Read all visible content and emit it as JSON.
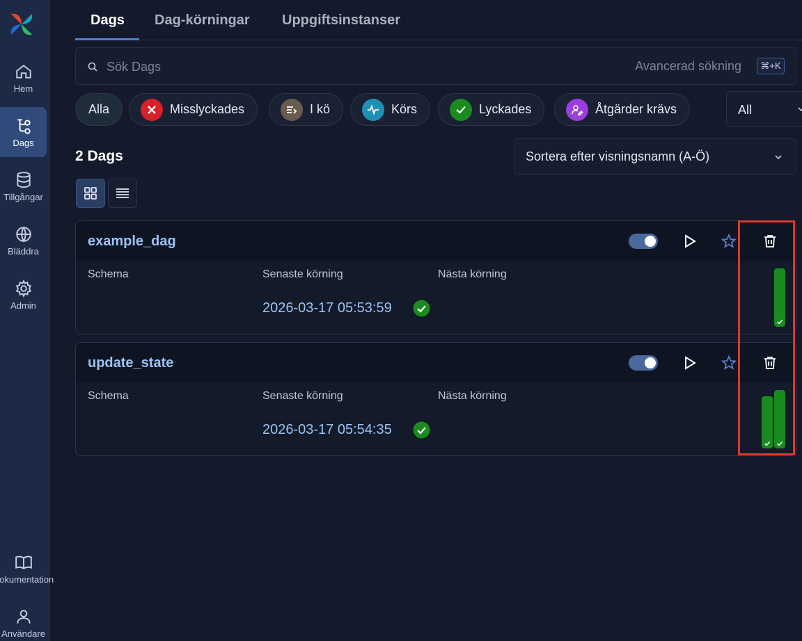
{
  "sidebar": {
    "items": [
      {
        "label": "Hem",
        "icon": "home-icon"
      },
      {
        "label": "Dags",
        "icon": "dags-icon",
        "active": true
      },
      {
        "label": "Tillgångar",
        "icon": "database-icon"
      },
      {
        "label": "Bläddra",
        "icon": "globe-icon"
      },
      {
        "label": "Admin",
        "icon": "gear-icon"
      },
      {
        "label": "Dokumentation",
        "icon": "book-icon"
      },
      {
        "label": "Användare",
        "icon": "user-icon"
      }
    ]
  },
  "tabs": [
    {
      "label": "Dags",
      "active": true
    },
    {
      "label": "Dag-körningar"
    },
    {
      "label": "Uppgiftsinstanser"
    }
  ],
  "search": {
    "placeholder": "Sök Dags",
    "advanced_label": "Avancerad sökning",
    "shortcut": "⌘+K"
  },
  "filters": {
    "pills": [
      {
        "label": "Alla"
      },
      {
        "label": "Misslyckades",
        "icon": "x-icon",
        "color": "#d6212a"
      },
      {
        "label": "I kö",
        "icon": "queue-icon",
        "color": "#6b5b4f"
      },
      {
        "label": "Körs",
        "icon": "pulse-icon",
        "color": "#1f8fb5"
      },
      {
        "label": "Lyckades",
        "icon": "check-icon",
        "color": "#1b8a1f"
      },
      {
        "label": "Åtgärder krävs",
        "icon": "user-edit-icon",
        "color": "#9b3de0"
      }
    ],
    "select_value": "All"
  },
  "list": {
    "count_label": "2 Dags",
    "sort_label": "Sortera efter visningsnamn (A-Ö)"
  },
  "columns": {
    "schedule": "Schema",
    "latest_run": "Senaste körning",
    "next_run": "Nästa körning"
  },
  "dags": [
    {
      "name": "example_dag",
      "latest_run": "2026-03-17 05:53:59",
      "status_color": "#1b8a1f",
      "enabled": true,
      "run_bar_levels": [
        1.0
      ]
    },
    {
      "name": "update_state",
      "latest_run": "2026-03-17 05:54:35",
      "status_color": "#1b8a1f",
      "enabled": true,
      "run_bar_levels": [
        0.9,
        1.0
      ]
    }
  ],
  "colors": {
    "accent": "#4a7fd4",
    "success": "#1b8a1f",
    "highlight": "#d73a2c"
  }
}
